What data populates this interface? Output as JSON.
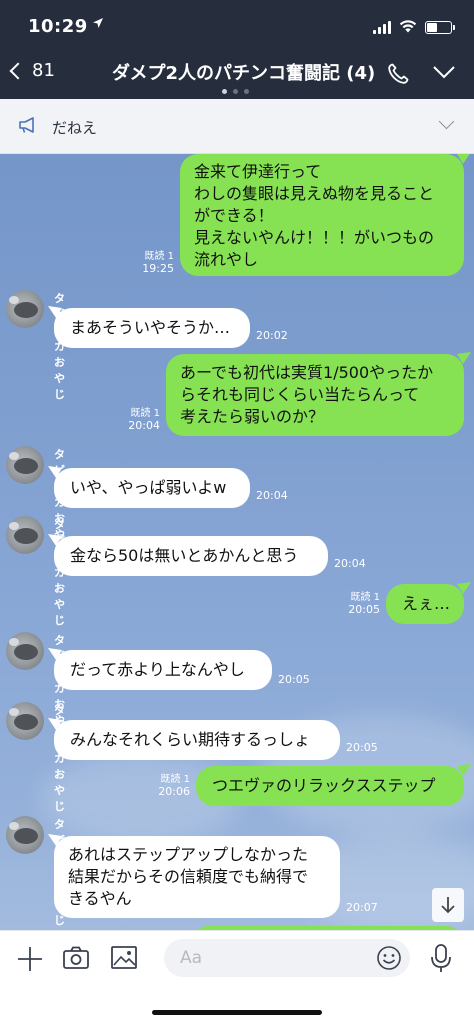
{
  "status": {
    "time": "10:29",
    "location_icon": "location-arrow-icon"
  },
  "header": {
    "back_count": "81",
    "title": "ダメプ2人のパチンコ奮闘記 (4)",
    "page_dots": 3,
    "active_dot": 0
  },
  "notice": {
    "text": "だねえ"
  },
  "messages": [
    {
      "id": "m1",
      "side": "me",
      "lines": [
        "金来て伊達行って",
        "わしの隻眼は見えぬ物を見ること",
        "ができる！",
        "見えないやんけ！！！がいつもの",
        "流れやし"
      ],
      "read": "既読 1",
      "time": "19:25"
    },
    {
      "id": "m2",
      "side": "them",
      "sender": "タピオカおやじ",
      "lines": [
        "まあそういやそうか…"
      ],
      "time": "20:02"
    },
    {
      "id": "m3",
      "side": "me",
      "lines": [
        "あーでも初代は実質1/500やったか",
        "らそれも同じくらい当たらんって",
        "考えたら弱いのか？"
      ],
      "read": "既読 1",
      "time": "20:04"
    },
    {
      "id": "m4",
      "side": "them",
      "sender": "タピオカおやじ",
      "lines": [
        "いや、やっぱ弱いよw"
      ],
      "time": "20:04"
    },
    {
      "id": "m5",
      "side": "them",
      "sender": "タピオカおやじ",
      "lines": [
        "金なら50は無いとあかんと思う"
      ],
      "time": "20:04"
    },
    {
      "id": "m6",
      "side": "me",
      "lines": [
        "えぇ…"
      ],
      "read": "既読 1",
      "time": "20:05"
    },
    {
      "id": "m7",
      "side": "them",
      "sender": "タピオカおやじ",
      "lines": [
        "だって赤より上なんやし"
      ],
      "time": "20:05"
    },
    {
      "id": "m8",
      "side": "them",
      "sender": "タピオカおやじ",
      "lines": [
        "みんなそれくらい期待するっしょ"
      ],
      "time": "20:05"
    },
    {
      "id": "m9",
      "side": "me",
      "lines": [
        "つエヴァのリラックスステップ"
      ],
      "read": "既読 1",
      "time": "20:06"
    },
    {
      "id": "m10",
      "side": "them",
      "sender": "タピオカおやじ",
      "lines": [
        "あれはステップアップしなかった",
        "結果だからその信頼度でも納得で",
        "きるやん"
      ],
      "time": "20:07"
    }
  ],
  "input": {
    "placeholder": "Aa"
  },
  "colors": {
    "header_bg": "#262d3d",
    "my_bubble": "#86e252",
    "their_bubble": "#ffffff",
    "chat_bg": "#7f9fd0"
  }
}
